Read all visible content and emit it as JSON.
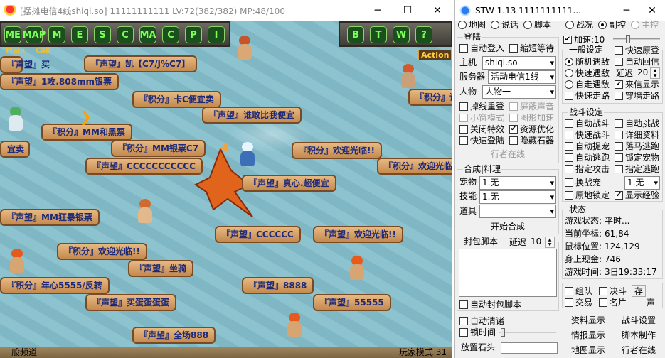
{
  "game_window": {
    "title": "[摆摊电信4线shiqi.so]   11111111111 LV:72(382/382) MP:48/100",
    "controls": {
      "minimize": "─",
      "maximize": "☐",
      "close": "✕"
    },
    "toolbar": {
      "main_label": "Main",
      "call_label": "Call",
      "action_label": "Action",
      "buttons": [
        "ME",
        "MAP",
        "M",
        "E",
        "S",
        "C",
        "MA",
        "C",
        "P",
        "I",
        "B",
        "T",
        "W",
        "H",
        "?"
      ]
    },
    "signs": [
      "『声望』凯【C7/J%C7】",
      "『声望』1攻.808mm银票",
      "『积分』卡C便宜卖",
      "『声望』谁敢比我便宜",
      "『积分』MM和黑票",
      "『积分』MM银票C7",
      "『积分』欢迎光临!!",
      "『积分』欢迎光临!!",
      "『声望』CCCCCCCCCCC",
      "『声望』真心.超便宜",
      "『声望』MM狂暴银票",
      "『声望』CCCCCC",
      "『声望』欢迎光临!!",
      "『积分』欢迎光临!!",
      "『声望』坐骑",
      "『声望』8888",
      "『积分』年心5555/反转",
      "『声望』买蛋蛋蛋蛋",
      "『声望』55555",
      "『声望』全场888",
      "『积分』谐",
      "『声望』买",
      "宜卖"
    ],
    "status_left": "一般频道",
    "status_right": "玩家模式   31"
  },
  "tool_window": {
    "title": "STW 1.13 1111111111...",
    "controls": {
      "minimize": "─",
      "close": "✕"
    },
    "menu": {
      "map": "地图",
      "talk": "说话",
      "script": "脚本"
    },
    "mode": {
      "battle": "战况",
      "sub": "副控",
      "main": "主控"
    },
    "login": {
      "title": "登陆",
      "auto_login": "自动登入",
      "shrink_wait": "缩短等待",
      "host_label": "主机",
      "host_value": "shiqi.so",
      "server_label": "服务器",
      "server_value": "活动电信1线",
      "char_label": "人物",
      "char_value": "人物一",
      "reconnect": "掉线重登",
      "mute": "屏蔽声音",
      "small_window": "小窗模式",
      "graphic_speed": "图形加速",
      "close_effects": "关闭特效",
      "optimize": "资源优化",
      "fast_login": "快速登陆",
      "hide_stone": "隐藏石器",
      "online_btn": "行者在线"
    },
    "synth": {
      "title": "合成|料理",
      "pet_label": "宠物",
      "pet_value": "1.无",
      "skill_label": "技能",
      "skill_value": "1.无",
      "item_label": "道具",
      "item_value": "",
      "start_btn": "开始合成"
    },
    "packet": {
      "title": "封包脚本",
      "delay_label": "延迟",
      "delay_value": "10",
      "auto_label": "自动封包脚本"
    },
    "auto_clean": "自动清诸",
    "lock_time": "锁时间",
    "place_stone": "放置石头",
    "speedup": {
      "label": "加速:",
      "value": "10"
    },
    "general": {
      "title": "一般设定",
      "orig_speed": "快速原登",
      "random_enc": "随机遇敌",
      "auto_reply": "自动回信",
      "fast_enc": "快速遇敌",
      "delay_label": "延迟",
      "delay_value": "20",
      "self_enc": "自走遇敌",
      "show_msg": "来信显示",
      "fast_walk": "快速走路",
      "wall_walk": "穿墙走路"
    },
    "battle": {
      "title": "战斗设定",
      "auto_battle": "自动战斗",
      "auto_challenge": "自动挑战",
      "fast_battle": "快速战斗",
      "detail_info": "详细资料",
      "auto_catch": "自动捉宠",
      "single_escape": "落马逃跑",
      "auto_escape": "自动逃跑",
      "lock_pet": "锁定宠物",
      "assign_attack": "指定攻击",
      "assign_escape": "指定逃跑",
      "change_pet": "换战宠",
      "change_pet_value": "1.无",
      "lock_in_place": "原地锁定",
      "show_exp": "显示经验"
    },
    "status": {
      "title": "状态",
      "rows": [
        {
          "label": "游戏状态:",
          "value": "平时..."
        },
        {
          "label": "当前坐标:",
          "value": "61,84"
        },
        {
          "label": "鼠标位置:",
          "value": "124,129"
        },
        {
          "label": "身上现金:",
          "value": "746"
        },
        {
          "label": "游戏时间:",
          "value": "3日19:33:17"
        }
      ]
    },
    "bottom": {
      "team": "组队",
      "duel": "决斗",
      "save": "存",
      "trade": "交易",
      "card": "名片",
      "sound": "声"
    },
    "links": {
      "data_show": "资料显示",
      "battle_set": "战斗设置",
      "report_show": "情报显示",
      "script_make": "脚本制作",
      "map_show": "地图显示",
      "walker_online": "行者在线"
    }
  }
}
